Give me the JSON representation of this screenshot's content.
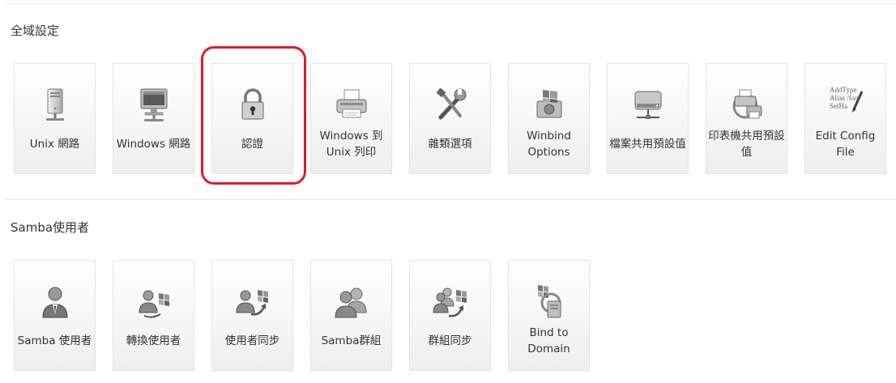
{
  "sections": [
    {
      "title": "全域設定",
      "items": [
        {
          "label": "Unix 網路",
          "icon": "server-tower-icon"
        },
        {
          "label": "Windows 網路",
          "icon": "computer-network-icon"
        },
        {
          "label": "認證",
          "icon": "padlock-icon"
        },
        {
          "label": "Windows 到 Unix 列印",
          "icon": "printer-icon"
        },
        {
          "label": "雜類選項",
          "icon": "tools-icon"
        },
        {
          "label": "Winbind Options",
          "icon": "winbind-drive-icon"
        },
        {
          "label": "檔案共用預設值",
          "icon": "shared-disk-icon"
        },
        {
          "label": "印表機共用預設值",
          "icon": "shared-printer-icon"
        },
        {
          "label": "Edit Config File",
          "icon": "edit-config-icon"
        }
      ]
    },
    {
      "title": "Samba使用者",
      "items": [
        {
          "label": "Samba 使用者",
          "icon": "user-icon"
        },
        {
          "label": "轉換使用者",
          "icon": "convert-users-icon"
        },
        {
          "label": "使用者同步",
          "icon": "user-sync-icon"
        },
        {
          "label": "Samba群組",
          "icon": "group-icon"
        },
        {
          "label": "群組同步",
          "icon": "group-sync-icon"
        },
        {
          "label": "Bind to Domain",
          "icon": "bind-domain-icon"
        }
      ]
    }
  ],
  "edit_config_icon_text": [
    "AddType",
    "Alias /foo",
    "SetHa"
  ],
  "highlight_color": "#e0192d"
}
